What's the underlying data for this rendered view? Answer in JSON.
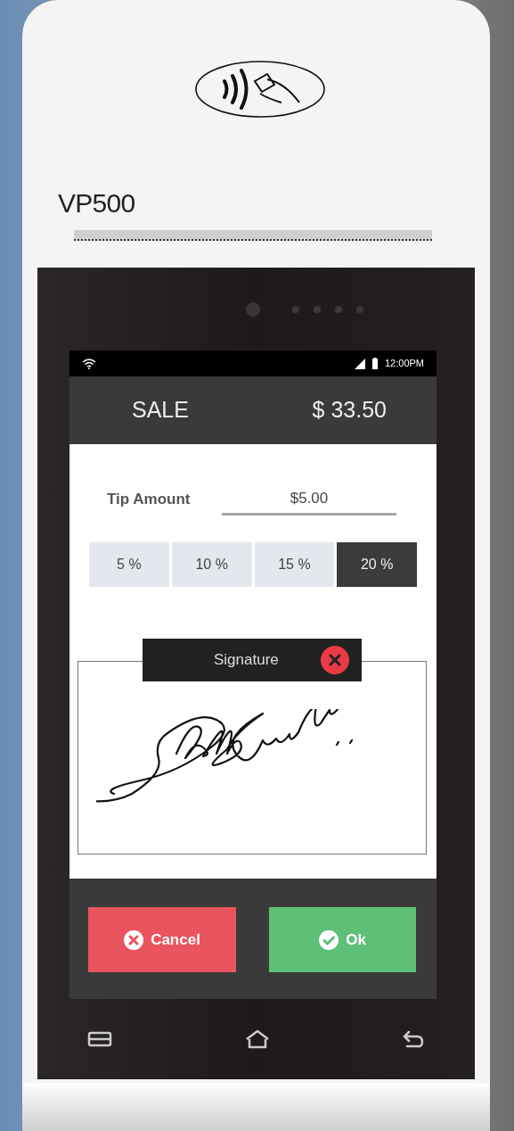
{
  "device": {
    "model": "VP500"
  },
  "status_bar": {
    "time": "12:00PM"
  },
  "header": {
    "title": "SALE",
    "amount": "$ 33.50"
  },
  "tip": {
    "label": "Tip Amount",
    "value": "$5.00"
  },
  "tip_options": [
    {
      "label": "5 %",
      "selected": false
    },
    {
      "label": "10 %",
      "selected": false
    },
    {
      "label": "15 %",
      "selected": false
    },
    {
      "label": "20 %",
      "selected": true
    }
  ],
  "signature": {
    "title": "Signature"
  },
  "buttons": [
    {
      "label": "Cancel",
      "kind": "cancel"
    },
    {
      "label": "Ok",
      "kind": "ok"
    }
  ]
}
